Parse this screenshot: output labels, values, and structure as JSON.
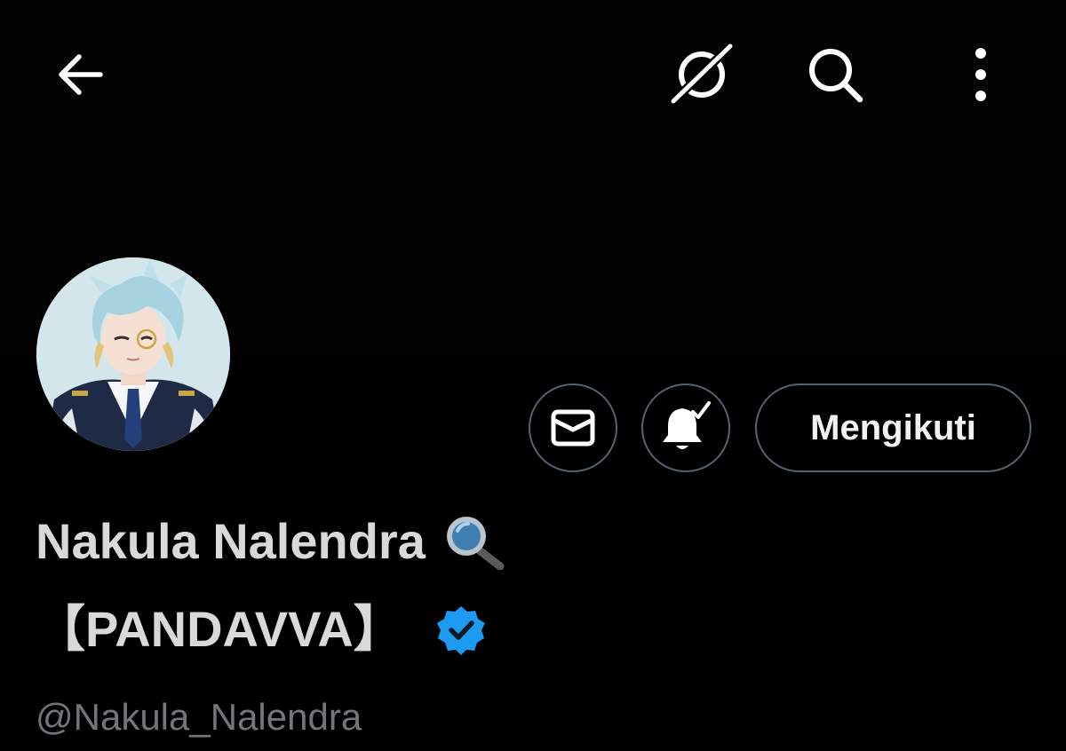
{
  "header": {
    "back_icon": "arrow-left-icon",
    "grok_icon": "grok-icon",
    "search_icon": "search-icon",
    "more_icon": "more-vertical-icon"
  },
  "profile": {
    "name_line1": "Nakula Nalendra",
    "name_emoji": "magnifying-glass-emoji",
    "name_line2": "【PANDAVVA】",
    "verified": true,
    "handle": "@Nakula_Nalendra"
  },
  "actions": {
    "message_icon": "mail-icon",
    "notify_icon": "bell-check-icon",
    "follow_label": "Mengikuti"
  },
  "colors": {
    "background": "#000000",
    "text_primary": "#d9d9d9",
    "text_secondary": "#71767b",
    "border": "#536471",
    "verified_blue": "#1d9bf0"
  }
}
